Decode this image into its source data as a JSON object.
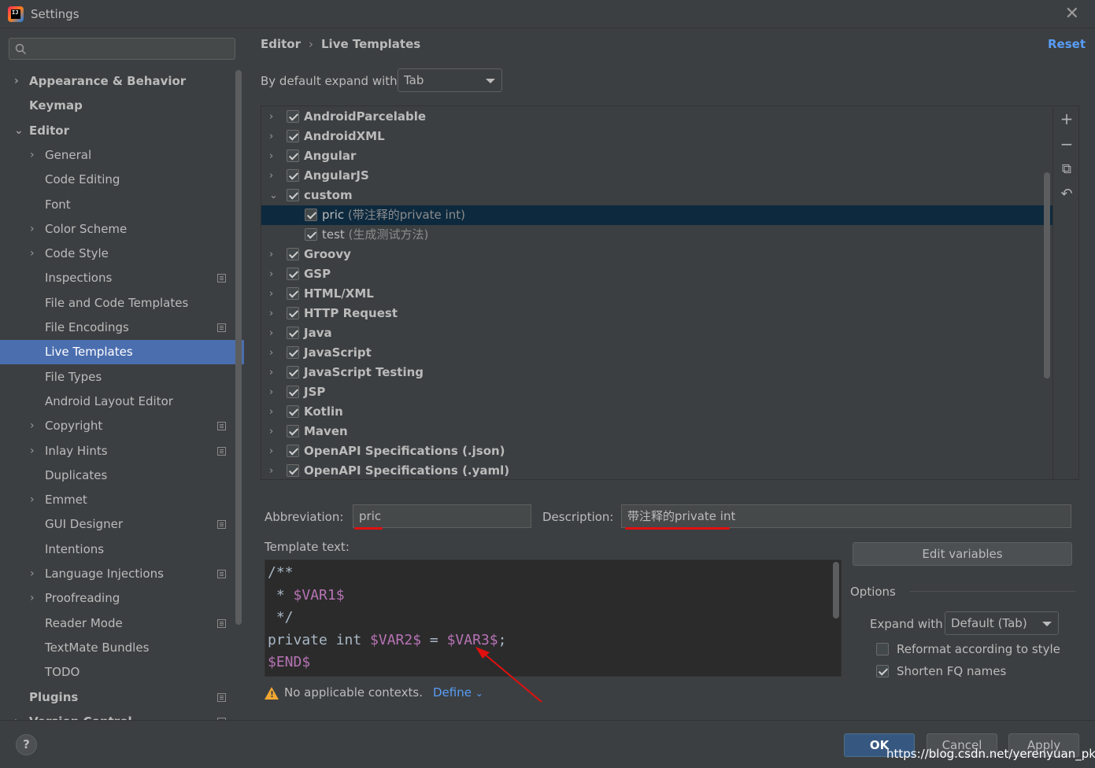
{
  "window": {
    "title": "Settings",
    "app_icon_text": "IJ"
  },
  "search": {
    "placeholder": ""
  },
  "sidebar": {
    "items": [
      {
        "label": "Appearance & Behavior",
        "arrow": "›",
        "bold": true
      },
      {
        "label": "Keymap",
        "bold": true
      },
      {
        "label": "Editor",
        "arrow": "⌄",
        "bold": true
      },
      {
        "label": "General",
        "arrow": "›"
      },
      {
        "label": "Code Editing"
      },
      {
        "label": "Font"
      },
      {
        "label": "Color Scheme",
        "arrow": "›"
      },
      {
        "label": "Code Style",
        "arrow": "›"
      },
      {
        "label": "Inspections",
        "project_icon": true
      },
      {
        "label": "File and Code Templates"
      },
      {
        "label": "File Encodings",
        "project_icon": true
      },
      {
        "label": "Live Templates",
        "selected": true
      },
      {
        "label": "File Types"
      },
      {
        "label": "Android Layout Editor"
      },
      {
        "label": "Copyright",
        "arrow": "›",
        "project_icon": true
      },
      {
        "label": "Inlay Hints",
        "arrow": "›",
        "project_icon": true
      },
      {
        "label": "Duplicates"
      },
      {
        "label": "Emmet",
        "arrow": "›"
      },
      {
        "label": "GUI Designer",
        "project_icon": true
      },
      {
        "label": "Intentions"
      },
      {
        "label": "Language Injections",
        "arrow": "›",
        "project_icon": true
      },
      {
        "label": "Proofreading",
        "arrow": "›"
      },
      {
        "label": "Reader Mode",
        "project_icon": true
      },
      {
        "label": "TextMate Bundles"
      },
      {
        "label": "TODO"
      },
      {
        "label": "Plugins",
        "bold": true,
        "project_icon": true
      },
      {
        "label": "Version Control",
        "arrow": "›",
        "bold": true,
        "project_icon": true
      }
    ]
  },
  "header": {
    "breadcrumb": [
      "Editor",
      "Live Templates"
    ],
    "breadcrumb_sep": "›",
    "reset_label": "Reset"
  },
  "expand": {
    "label": "By default expand with",
    "value": "Tab"
  },
  "templates": [
    {
      "name": "AndroidParcelable",
      "group": true,
      "checked": true,
      "chevron": "›"
    },
    {
      "name": "AndroidXML",
      "group": true,
      "checked": true,
      "chevron": "›"
    },
    {
      "name": "Angular",
      "group": true,
      "checked": true,
      "chevron": "›"
    },
    {
      "name": "AngularJS",
      "group": true,
      "checked": true,
      "chevron": "›"
    },
    {
      "name": "custom",
      "group": true,
      "checked": true,
      "chevron": "⌄"
    },
    {
      "name": "pric",
      "desc": "(带注释的private int)",
      "group": false,
      "checked": true,
      "selected": true
    },
    {
      "name": "test",
      "desc": "(生成测试方法)",
      "group": false,
      "checked": true
    },
    {
      "name": "Groovy",
      "group": true,
      "checked": true,
      "chevron": "›"
    },
    {
      "name": "GSP",
      "group": true,
      "checked": true,
      "chevron": "›"
    },
    {
      "name": "HTML/XML",
      "group": true,
      "checked": true,
      "chevron": "›"
    },
    {
      "name": "HTTP Request",
      "group": true,
      "checked": true,
      "chevron": "›"
    },
    {
      "name": "Java",
      "group": true,
      "checked": true,
      "chevron": "›"
    },
    {
      "name": "JavaScript",
      "group": true,
      "checked": true,
      "chevron": "›"
    },
    {
      "name": "JavaScript Testing",
      "group": true,
      "checked": true,
      "chevron": "›"
    },
    {
      "name": "JSP",
      "group": true,
      "checked": true,
      "chevron": "›"
    },
    {
      "name": "Kotlin",
      "group": true,
      "checked": true,
      "chevron": "›"
    },
    {
      "name": "Maven",
      "group": true,
      "checked": true,
      "chevron": "›"
    },
    {
      "name": "OpenAPI Specifications (.json)",
      "group": true,
      "checked": true,
      "chevron": "›"
    },
    {
      "name": "OpenAPI Specifications (.yaml)",
      "group": true,
      "checked": true,
      "chevron": "›"
    }
  ],
  "toolbar": {
    "add": "+",
    "remove": "−",
    "copy": "⧉",
    "restore": "↶"
  },
  "editor_panel": {
    "abbreviation_label": "Abbreviation:",
    "abbreviation_value": "pric",
    "description_label": "Description:",
    "description_value": "带注释的private int",
    "template_text_label": "Template text:",
    "code_lines": [
      [
        {
          "t": "/**"
        }
      ],
      [
        {
          "t": " * "
        },
        {
          "t": "$VAR1$",
          "v": true
        }
      ],
      [
        {
          "t": " */"
        }
      ],
      [
        {
          "t": "private int "
        },
        {
          "t": "$VAR2$",
          "v": true
        },
        {
          "t": " = "
        },
        {
          "t": "$VAR3$",
          "v": true
        },
        {
          "t": ";"
        }
      ],
      [
        {
          "t": "$END$",
          "v": true
        }
      ]
    ],
    "warning_text": "No applicable contexts.",
    "define_label": "Define",
    "define_caret": "⌄",
    "edit_variables_label": "Edit variables"
  },
  "options": {
    "title": "Options",
    "expand_with_label": "Expand with",
    "expand_with_value": "Default (Tab)",
    "reformat_label": "Reformat according to style",
    "reformat_checked": false,
    "shorten_label": "Shorten FQ names",
    "shorten_checked": true
  },
  "footer": {
    "help": "?",
    "ok": "OK",
    "cancel": "Cancel",
    "apply": "Apply",
    "watermark": "https://blog.csdn.net/yerenyuan_pku"
  },
  "colors": {
    "accent": "#4b6eaf",
    "link": "#589df6",
    "annotation_red": "#e01010",
    "template_var": "#b673b4"
  }
}
